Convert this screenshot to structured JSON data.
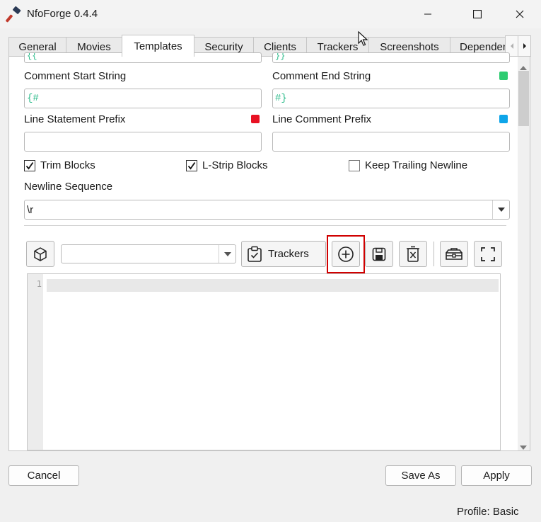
{
  "window": {
    "title": "NfoForge 0.4.4",
    "controls": [
      "minimize-icon",
      "maximize-icon",
      "close-icon"
    ]
  },
  "tabs": [
    {
      "label": "General",
      "active": false
    },
    {
      "label": "Movies",
      "active": false
    },
    {
      "label": "Templates",
      "active": true
    },
    {
      "label": "Security",
      "active": false
    },
    {
      "label": "Clients",
      "active": false
    },
    {
      "label": "Trackers",
      "active": false
    },
    {
      "label": "Screenshots",
      "active": false
    },
    {
      "label": "Dependen",
      "active": false
    }
  ],
  "templates": {
    "top_partial_left": "{{",
    "top_partial_right": "}}",
    "comment_start": {
      "label": "Comment Start String",
      "value": "{#"
    },
    "comment_end": {
      "label": "Comment End String",
      "value": "#}",
      "color": "#2ecc71"
    },
    "line_statement": {
      "label": "Line Statement Prefix",
      "value": "",
      "color": "#e81123"
    },
    "line_comment": {
      "label": "Line Comment Prefix",
      "value": "",
      "color": "#0ea5e9"
    },
    "trim_blocks": {
      "label": "Trim Blocks",
      "checked": true
    },
    "lstrip_blocks": {
      "label": "L-Strip Blocks",
      "checked": true
    },
    "keep_trailing_newline": {
      "label": "Keep Trailing Newline",
      "checked": false
    },
    "newline_sequence": {
      "label": "Newline Sequence",
      "value": "\\r"
    }
  },
  "toolbar": {
    "template_select_value": "",
    "trackers_label": "Trackers",
    "icons": [
      "cube-icon",
      "clipboard-check-icon",
      "plus-circle-icon",
      "save-icon",
      "delete-icon",
      "toolbox-icon",
      "fullscreen-icon"
    ],
    "highlight_color": "#d00000"
  },
  "editor": {
    "line_numbers": [
      "1"
    ],
    "content": ""
  },
  "footer": {
    "cancel_label": "Cancel",
    "save_as_label": "Save As",
    "apply_label": "Apply",
    "profile_text": "Profile: Basic"
  }
}
